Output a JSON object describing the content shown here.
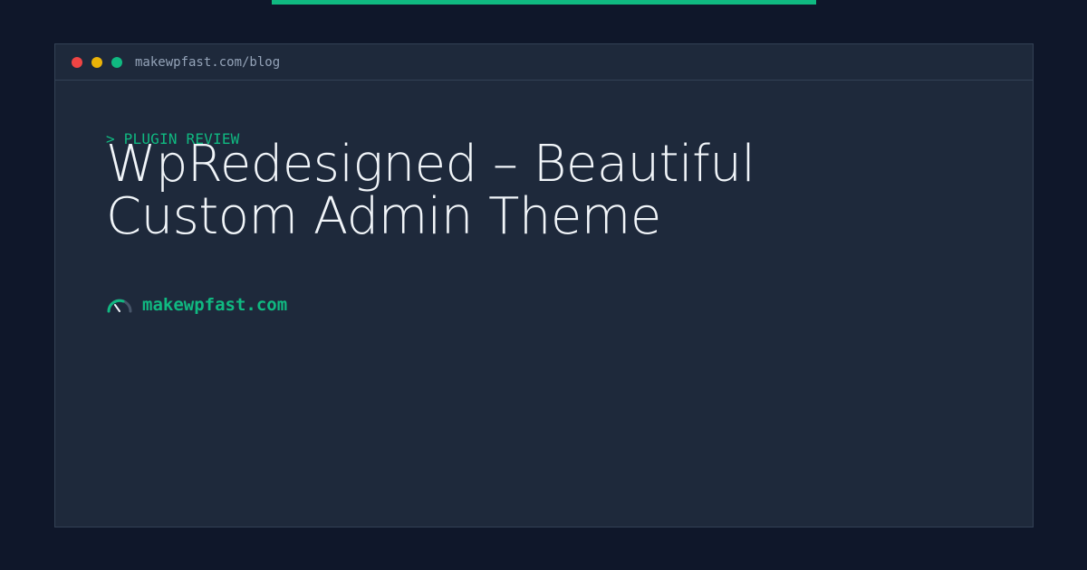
{
  "window": {
    "url": "makewpfast.com/blog",
    "controls": [
      "close-dot",
      "minimize-dot",
      "maximize-dot"
    ]
  },
  "post": {
    "eyebrow": "> PLUGIN REVIEW",
    "title": "WpRedesigned – Beautiful Custom Admin Theme"
  },
  "brand": {
    "name": "makewpfast.com",
    "icon": "speedometer-icon"
  },
  "colors": {
    "background": "#0f172a",
    "window": "#1e293b",
    "accent": "#10b981",
    "title_text": "#f1f5f9",
    "muted_text": "#94a3b8",
    "close": "#ef4444",
    "minimize": "#eab308",
    "maximize": "#10b981"
  }
}
